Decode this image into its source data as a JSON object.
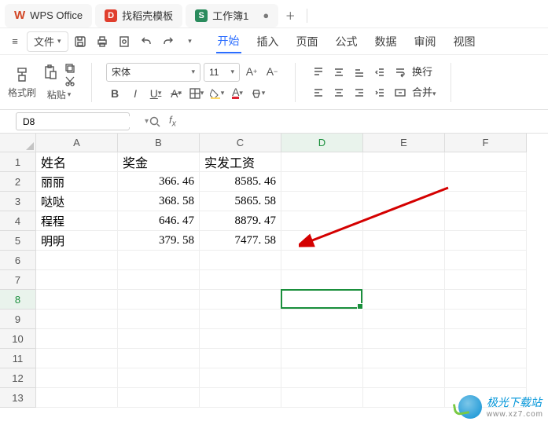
{
  "tabs": {
    "app": "WPS Office",
    "template": "找稻壳模板",
    "workbook": "工作簿1"
  },
  "menu": {
    "file": "文件",
    "items": [
      "开始",
      "插入",
      "页面",
      "公式",
      "数据",
      "审阅",
      "视图"
    ],
    "active_index": 0
  },
  "ribbon": {
    "format_painter": "格式刷",
    "paste": "粘贴",
    "font_name": "宋体",
    "font_size": "11",
    "wrap": "换行",
    "merge": "合并"
  },
  "namebox": "D8",
  "columns": [
    "A",
    "B",
    "C",
    "D",
    "E",
    "F"
  ],
  "rows": [
    "1",
    "2",
    "3",
    "4",
    "5",
    "6",
    "7",
    "8",
    "9",
    "10",
    "11",
    "12",
    "13"
  ],
  "active_col_index": 3,
  "active_row_index": 7,
  "data": {
    "headers": [
      "姓名",
      "奖金",
      "实发工资"
    ],
    "rows": [
      {
        "name": "丽丽",
        "bonus": "366. 46",
        "salary": "8585. 46"
      },
      {
        "name": "哒哒",
        "bonus": "368. 58",
        "salary": "5865. 58"
      },
      {
        "name": "程程",
        "bonus": "646. 47",
        "salary": "8879. 47"
      },
      {
        "name": "明明",
        "bonus": "379. 58",
        "salary": "7477. 58"
      }
    ]
  },
  "watermark": {
    "title": "极光下载站",
    "url": "www.xz7.com"
  },
  "chart_data": {
    "type": "table",
    "columns": [
      "姓名",
      "奖金",
      "实发工资"
    ],
    "rows": [
      [
        "丽丽",
        366.46,
        8585.46
      ],
      [
        "哒哒",
        368.58,
        5865.58
      ],
      [
        "程程",
        646.47,
        8879.47
      ],
      [
        "明明",
        379.58,
        7477.58
      ]
    ]
  }
}
